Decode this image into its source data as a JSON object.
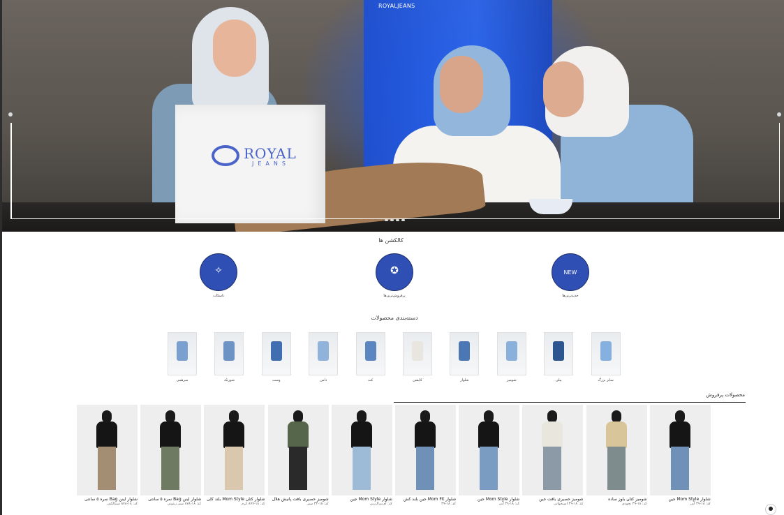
{
  "header": {
    "logo_text": "ROYALJEANS",
    "top_links": [
      "",
      "",
      ""
    ]
  },
  "hero": {
    "bag_logo_word": "ROYAL",
    "bag_logo_sub": "JEANS"
  },
  "collections": {
    "title": "کالکشن ها",
    "items": [
      {
        "label": "ناسکات",
        "icon": "sparkle-icon"
      },
      {
        "label": "پرفروش‌ترین‌ها",
        "icon": "award-icon"
      },
      {
        "label": "جدیدترین‌ها",
        "icon": "new-badge-icon"
      }
    ]
  },
  "categories": {
    "title": "دسته‌بندی محصولات",
    "items": [
      {
        "label": "سرهمی",
        "color": "#7aa0cf"
      },
      {
        "label": "شورتک",
        "color": "#6d93c4"
      },
      {
        "label": "وست",
        "color": "#3f6fb0"
      },
      {
        "label": "دامن",
        "color": "#8fb3da"
      },
      {
        "label": "کت",
        "color": "#5c86c0"
      },
      {
        "label": "کاپشن",
        "color": "#e8e6df"
      },
      {
        "label": "شلوار",
        "color": "#4b77b5"
      },
      {
        "label": "شومیز",
        "color": "#8ab0dc"
      },
      {
        "label": "پیلی",
        "color": "#2d5590"
      },
      {
        "label": "سایز بزرگ",
        "color": "#86b0e0"
      }
    ]
  },
  "bestsellers": {
    "title": "محصولات پرفروش",
    "products": [
      {
        "title": "شلوار لینن Bag نمره ۵ سانتی",
        "sub": "کد: ۱۸-۸۷۸ سنتالکتی",
        "pants": "#a38d73",
        "top": "#151515"
      },
      {
        "title": "شلوار لینن Bag نمره ۵ سانتی",
        "sub": "کد: ۱۸-۸۷۸ سبز زیتونی",
        "pants": "#6f7a62",
        "top": "#151515"
      },
      {
        "title": "شلوار کتان Mom Style بلند کلی",
        "sub": "کد: ۱۸-۸۷۷ کرم",
        "pants": "#d9c8ae",
        "top": "#151515"
      },
      {
        "title": "شومیز حصیری بافت پانیش هلال",
        "sub": "کد: ۱۸-۳۳ سبز",
        "pants": "#2a2a2a",
        "top": "#55664a"
      },
      {
        "title": "شلوار Mom Style جین",
        "sub": "کد: آی‌بی‌ال‌زین",
        "pants": "#9dbbd6",
        "top": "#151515"
      },
      {
        "title": "شلوار Mom Fit جین بلند کش",
        "sub": "کد: ۱۸-۳۹",
        "pants": "#6f91b8",
        "top": "#151515"
      },
      {
        "title": "شلوار Mom Style جین",
        "sub": "کد: ۱۸-۳۹ آبی",
        "pants": "#7a9cc3",
        "top": "#151515"
      },
      {
        "title": "شومیز حصیری بافت جین",
        "sub": "کد: ۱۸-۳۹ استخوانی",
        "pants": "#8c9aa8",
        "top": "#e9e6de"
      },
      {
        "title": "شومیز کتان بلوز ساده",
        "sub": "کد: ۱۸-۳۹ نخودی",
        "pants": "#7f8c8d",
        "top": "#d8c59a"
      },
      {
        "title": "شلوار Mom Style جین",
        "sub": "کد: ۱۸-۳۹ آبی",
        "pants": "#6f91b8",
        "top": "#151515"
      }
    ]
  }
}
